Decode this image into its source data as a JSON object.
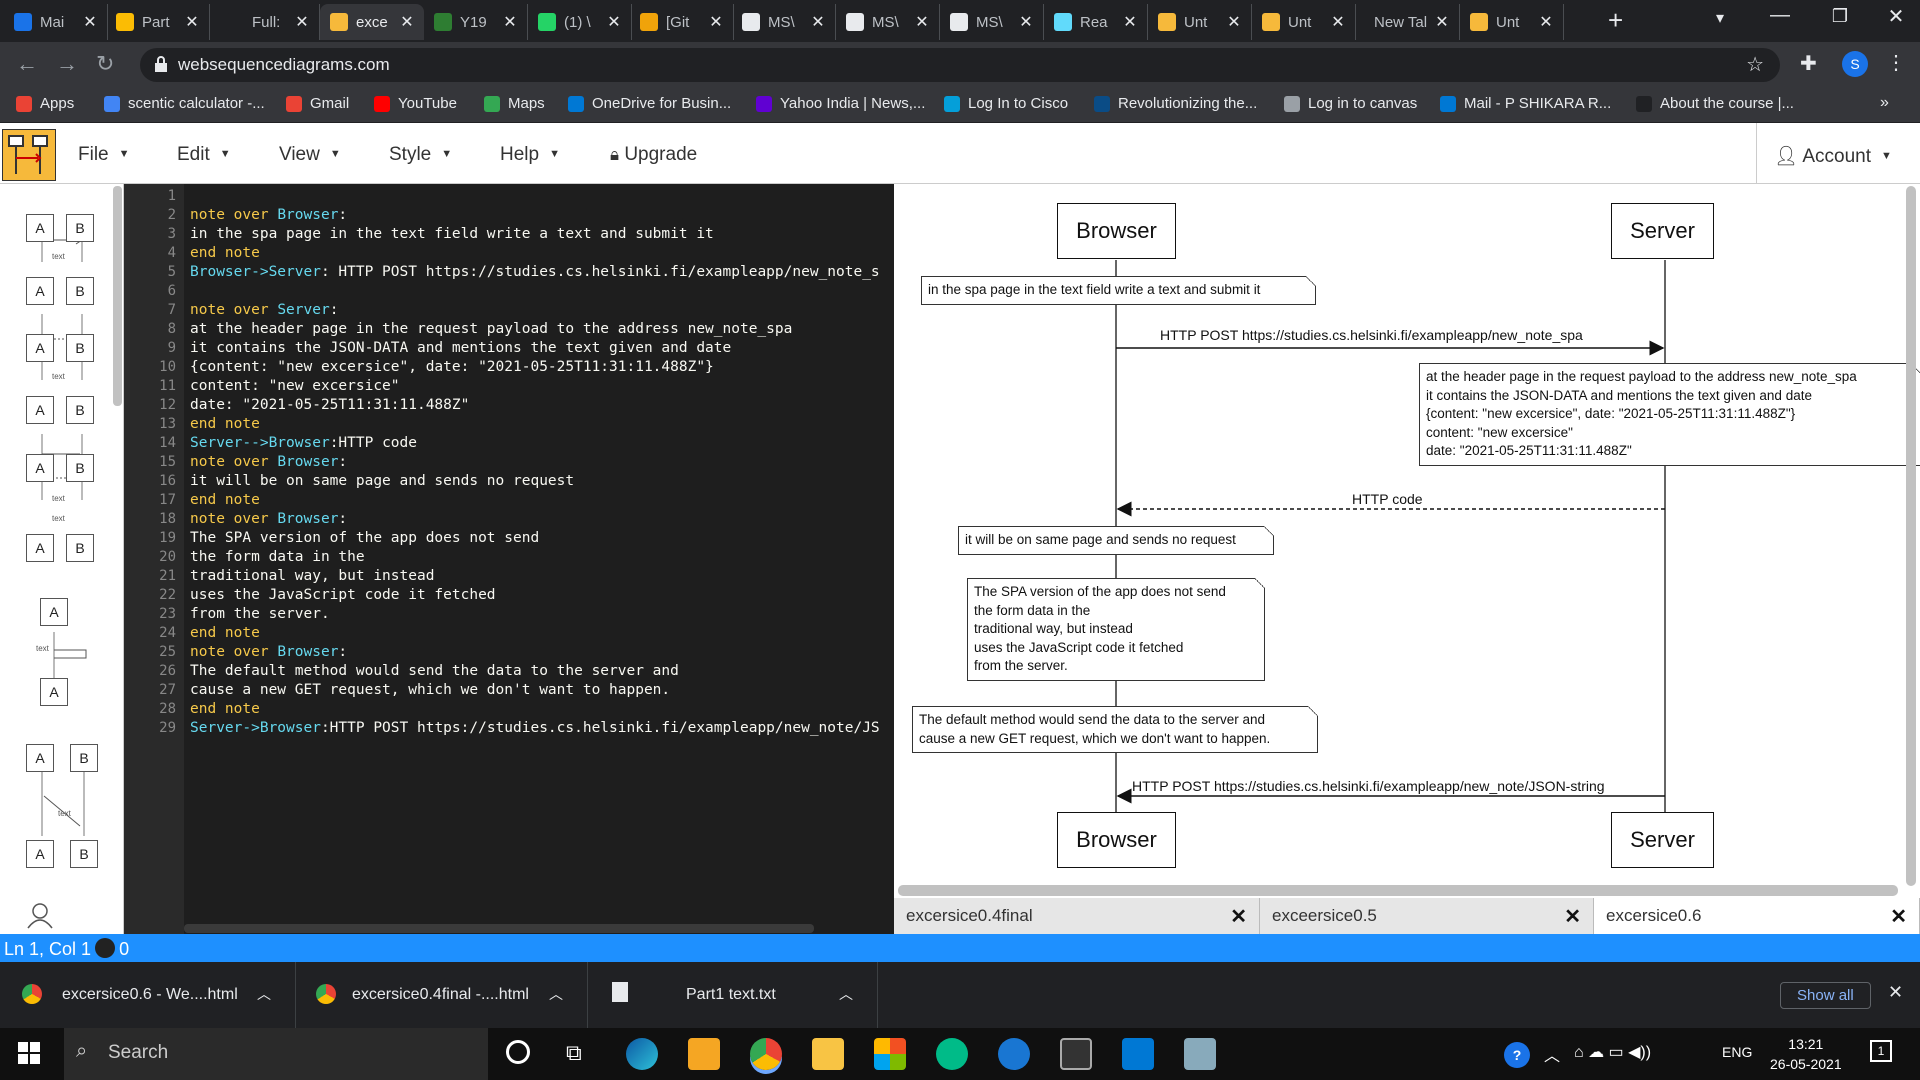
{
  "browser": {
    "tabs": [
      {
        "title": "Mai",
        "color": "#1a73e8"
      },
      {
        "title": "Part",
        "color": "#fbbc04"
      },
      {
        "title": "Full:",
        "color": "#202124"
      },
      {
        "title": "exce",
        "color": "#f6b93b",
        "active": true
      },
      {
        "title": "Y19",
        "color": "#2e7d32"
      },
      {
        "title": "(1) \\",
        "color": "#25d366"
      },
      {
        "title": "[Git",
        "color": "#f0a30a"
      },
      {
        "title": "MS\\",
        "color": "#e8eaed"
      },
      {
        "title": "MS\\",
        "color": "#e8eaed"
      },
      {
        "title": "MS\\",
        "color": "#e8eaed"
      },
      {
        "title": "Rea",
        "color": "#61dafb"
      },
      {
        "title": "Unt",
        "color": "#f6b93b"
      },
      {
        "title": "Unt",
        "color": "#f6b93b"
      },
      {
        "title": "New Tal",
        "color": ""
      },
      {
        "title": "Unt",
        "color": "#f6b93b"
      }
    ],
    "url": "websequencediagrams.com",
    "profile_initial": "S",
    "bookmarks": [
      {
        "label": "Apps",
        "color": "#ea4335"
      },
      {
        "label": "scentic calculator -...",
        "color": "#4285f4"
      },
      {
        "label": "Gmail",
        "color": "#ea4335"
      },
      {
        "label": "YouTube",
        "color": "#ff0000"
      },
      {
        "label": "Maps",
        "color": "#34a853"
      },
      {
        "label": "OneDrive for Busin...",
        "color": "#0078d4"
      },
      {
        "label": "Yahoo India | News,...",
        "color": "#6001d2"
      },
      {
        "label": "Log In to Cisco",
        "color": "#049fd9"
      },
      {
        "label": "Revolutionizing the...",
        "color": "#0a4c86"
      },
      {
        "label": "Log in to canvas",
        "color": "#9aa0a6"
      },
      {
        "label": "Mail - P SHIKARA R...",
        "color": "#0078d4"
      },
      {
        "label": "About the course |...",
        "color": "#202124"
      }
    ]
  },
  "app": {
    "menus": [
      "File",
      "Edit",
      "View",
      "Style",
      "Help"
    ],
    "upgrade": "Upgrade",
    "account": "Account",
    "palette_text": "text",
    "palette": {
      "a": "A",
      "b": "B"
    }
  },
  "editor": {
    "lines": [
      [
        [
          "",
          ""
        ]
      ],
      [
        [
          "kw",
          "note over "
        ],
        [
          "ac",
          "Browser"
        ],
        [
          "",
          ":"
        ]
      ],
      [
        [
          "",
          "in the spa page in the text field write a text and submit it"
        ]
      ],
      [
        [
          "kw",
          "end note"
        ]
      ],
      [
        [
          "ac",
          "Browser->Server"
        ],
        [
          "",
          ": HTTP POST https://studies.cs.helsinki.fi/exampleapp/new_note_s"
        ]
      ],
      [
        [
          "",
          ""
        ]
      ],
      [
        [
          "kw",
          "note over "
        ],
        [
          "ac",
          "Server"
        ],
        [
          "",
          ":"
        ]
      ],
      [
        [
          "",
          "at the header page in the request payload to the address new_note_spa"
        ]
      ],
      [
        [
          "",
          "it contains the JSON-DATA and mentions the text given and date"
        ]
      ],
      [
        [
          "",
          "{content: \"new excersice\", date: \"2021-05-25T11:31:11.488Z\"}"
        ]
      ],
      [
        [
          "",
          "content: \"new excersice\""
        ]
      ],
      [
        [
          "",
          "date: \"2021-05-25T11:31:11.488Z\""
        ]
      ],
      [
        [
          "kw",
          "end note"
        ]
      ],
      [
        [
          "ac",
          "Server-->Browser"
        ],
        [
          "",
          ":HTTP code"
        ]
      ],
      [
        [
          "kw",
          "note over "
        ],
        [
          "ac",
          "Browser"
        ],
        [
          "",
          ":"
        ]
      ],
      [
        [
          "",
          "it will be on same page and sends no request"
        ]
      ],
      [
        [
          "kw",
          "end note"
        ]
      ],
      [
        [
          "kw",
          "note over "
        ],
        [
          "ac",
          "Browser"
        ],
        [
          "",
          ":"
        ]
      ],
      [
        [
          "",
          "The SPA version of the app does not send"
        ]
      ],
      [
        [
          "",
          "the form data in the"
        ]
      ],
      [
        [
          "",
          "traditional way, but instead"
        ]
      ],
      [
        [
          "",
          "uses the JavaScript code it fetched"
        ]
      ],
      [
        [
          "",
          "from the server."
        ]
      ],
      [
        [
          "kw",
          "end note"
        ]
      ],
      [
        [
          "kw",
          "note over "
        ],
        [
          "ac",
          "Browser"
        ],
        [
          "",
          ":"
        ]
      ],
      [
        [
          "",
          "The default method would send the data to the server and"
        ]
      ],
      [
        [
          "",
          "cause a new GET request, which we don't want to happen."
        ]
      ],
      [
        [
          "kw",
          "end note"
        ]
      ],
      [
        [
          "ac",
          "Server->Browser"
        ],
        [
          "",
          ":HTTP POST https://studies.cs.helsinki.fi/exampleapp/new_note/JS"
        ]
      ]
    ]
  },
  "diagram": {
    "actor_left": "Browser",
    "actor_right": "Server",
    "note1": "in the spa page in the text field write a text and submit it",
    "msg1": "HTTP POST https://studies.cs.helsinki.fi/exampleapp/new_note_spa",
    "note2": "at the header page in the request payload to the address new_note_spa\nit contains the JSON-DATA and mentions the text given and date\n{content: \"new excersice\", date: \"2021-05-25T11:31:11.488Z\"}\ncontent: \"new excersice\"\ndate: \"2021-05-25T11:31:11.488Z\"",
    "msg2": "HTTP code",
    "note3": "it will be on same page and sends no request",
    "note4": "The SPA version of the app does not send\nthe form data in the\ntraditional way, but instead\nuses the JavaScript code it fetched\nfrom the server.",
    "note5": "The default method would send the data to the server and\ncause a new GET request, which we don't want to happen.",
    "msg3": "HTTP POST https://studies.cs.helsinki.fi/exampleapp/new_note/JSON-string"
  },
  "doc_tabs": [
    "excersice0.4final",
    "exceersice0.5",
    "excersice0.6"
  ],
  "status": {
    "position": "Ln 1, Col 1",
    "errors": "0"
  },
  "downloads": {
    "items": [
      "excersice0.6 - We....html",
      "excersice0.4final -....html",
      "Part1 text.txt"
    ],
    "show_all": "Show all"
  },
  "taskbar": {
    "search": "Search",
    "lang": "ENG",
    "time": "13:21",
    "date": "26-05-2021",
    "notif_count": "1"
  }
}
